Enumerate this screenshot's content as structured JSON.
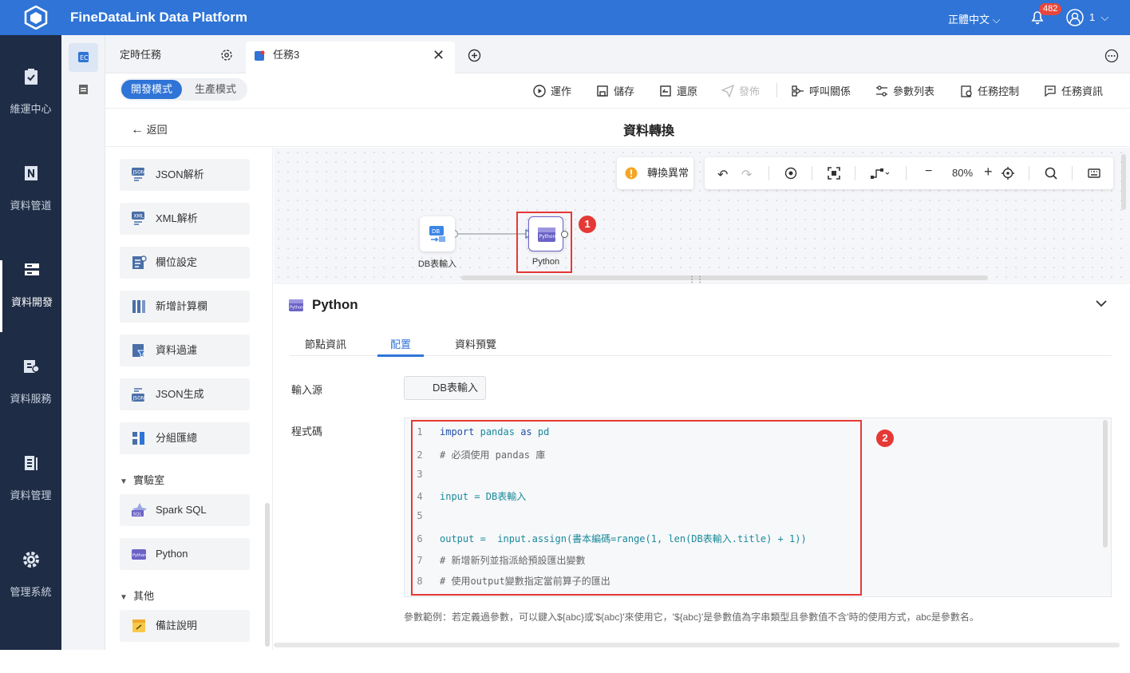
{
  "app": {
    "title": "FineDataLink Data Platform",
    "language": "正體中文",
    "notifications": "482",
    "user": "1"
  },
  "nav": {
    "items": [
      {
        "label": "維運中心",
        "icon": "clipboard-check-icon"
      },
      {
        "label": "資料管道",
        "icon": "pipeline-icon"
      },
      {
        "label": "資料開發",
        "icon": "server-icon",
        "active": true
      },
      {
        "label": "資料服務",
        "icon": "api-icon"
      },
      {
        "label": "資料管理",
        "icon": "bar-list-icon"
      },
      {
        "label": "管理系統",
        "icon": "gear-icon"
      }
    ],
    "collapse": "»"
  },
  "tabs": {
    "items": [
      "定時任務",
      "任務3"
    ]
  },
  "mode": {
    "dev": "開發模式",
    "prod": "生產模式"
  },
  "toolbar": {
    "run": "運作",
    "save": "儲存",
    "revert": "還原",
    "publish": "發佈",
    "call": "呼叫關係",
    "params": "參數列表",
    "control": "任務控制",
    "info": "任務資訊"
  },
  "header": {
    "back": "返回",
    "title": "資料轉換"
  },
  "palette": {
    "items": [
      "JSON解析",
      "XML解析",
      "欄位設定",
      "新增計算欄",
      "資料過濾",
      "JSON生成",
      "分組匯總"
    ],
    "lab_group": "實驗室",
    "lab_items": [
      "Spark SQL",
      "Python"
    ],
    "other_group": "其他",
    "other_items": [
      "備註說明"
    ]
  },
  "canvas": {
    "exception_btn": "轉換異常",
    "zoom": "80%",
    "nodes": [
      {
        "label": "DB表輸入"
      },
      {
        "label": "Python",
        "icon_text": "Python"
      }
    ],
    "markers": [
      "1",
      "2"
    ],
    "db_icon_text": "DB"
  },
  "panel": {
    "title": "Python",
    "tabs": [
      "節點資訊",
      "配置",
      "資料預覽"
    ],
    "active_tab": "配置",
    "source_label": "輸入源",
    "source_value": "DB表輸入",
    "code_label": "程式碼",
    "code_lines": [
      {
        "n": "1",
        "text": "import pandas as pd"
      },
      {
        "n": "2",
        "text": "# 必須使用 pandas 庫"
      },
      {
        "n": "3",
        "text": ""
      },
      {
        "n": "4",
        "text": "input = DB表輸入"
      },
      {
        "n": "5",
        "text": ""
      },
      {
        "n": "6",
        "text": "output =  input.assign(書本編碼=range(1, len(DB表輸入.title) + 1))"
      },
      {
        "n": "7",
        "text": "# 新增新列並指派給預設匯出變數"
      },
      {
        "n": "8",
        "text": "# 使用output變數指定當前算子的匯出"
      }
    ],
    "hint": "參數範例：若定義過參數，可以鍵入${abc}或'${abc}'來使用它，'${abc}'是參數值為字串類型且參數值不含'時的使用方式，abc是參數名。"
  },
  "colors": {
    "primary": "#2f74d6",
    "nav_bg": "#1e2c45",
    "marker": "#e53935"
  }
}
